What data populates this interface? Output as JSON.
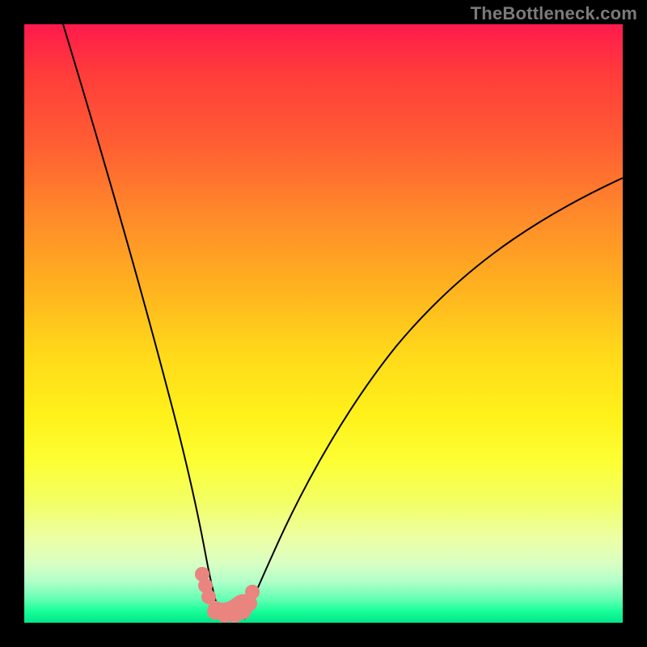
{
  "watermark": "TheBottleneck.com",
  "chart_data": {
    "type": "line",
    "title": "",
    "xlabel": "",
    "ylabel": "",
    "xlim": [
      0,
      100
    ],
    "ylim": [
      0,
      100
    ],
    "series": [
      {
        "name": "left-curve",
        "x": [
          0,
          5,
          10,
          15,
          20,
          24,
          26,
          28,
          30,
          31
        ],
        "values": [
          100,
          85,
          70,
          54,
          38,
          20,
          12,
          6,
          2,
          0
        ]
      },
      {
        "name": "right-curve",
        "x": [
          35,
          37,
          40,
          45,
          50,
          58,
          66,
          75,
          85,
          100
        ],
        "values": [
          0,
          3,
          8,
          18,
          28,
          40,
          50,
          58,
          66,
          75
        ]
      }
    ],
    "highlight_points": {
      "name": "bottom-blob",
      "x": [
        28,
        29,
        30,
        31,
        32,
        33,
        34,
        35,
        36
      ],
      "values": [
        6,
        3,
        1,
        0,
        0,
        0,
        0,
        1,
        4
      ]
    }
  }
}
